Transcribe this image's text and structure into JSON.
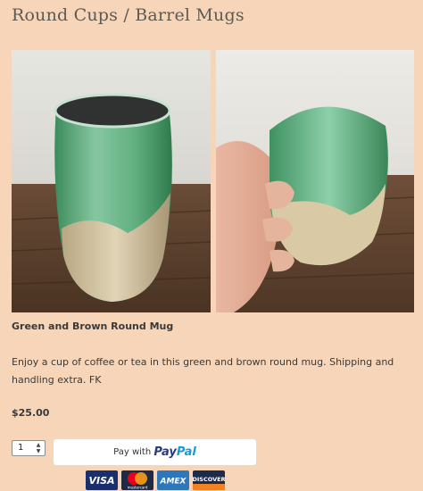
{
  "page": {
    "title": "Round Cups / Barrel Mugs"
  },
  "photos": [
    {
      "alt": "green and brown round mug on wooden table",
      "icon": "mug-photo"
    },
    {
      "alt": "green and brown round mug held in hand",
      "icon": "mug-in-hand-photo"
    }
  ],
  "product": {
    "name": "Green and Brown Round Mug",
    "description": "Enjoy a cup of coffee or tea in this green and brown round mug. Shipping and handling extra. FK",
    "price": "$25.00"
  },
  "purchase": {
    "quantity": "1",
    "paypal_prefix": "Pay with",
    "paypal_brand_pay": "Pay",
    "paypal_brand_pal": "Pal"
  },
  "cards": [
    {
      "name": "VISA",
      "icon": "visa-icon"
    },
    {
      "name": "mastercard",
      "icon": "mastercard-icon"
    },
    {
      "name": "AMEX",
      "icon": "amex-icon"
    },
    {
      "name": "DISCOVER",
      "icon": "discover-icon"
    }
  ],
  "colors": {
    "background": "#f6d5b8",
    "title": "#5e5a52",
    "paypal_blue_dark": "#253b80",
    "paypal_blue_light": "#179bd7"
  }
}
